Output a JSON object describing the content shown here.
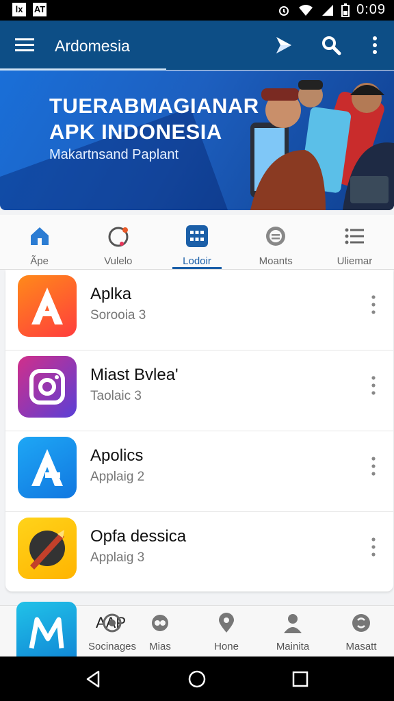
{
  "status_bar": {
    "left_icons": [
      "lx",
      "AT"
    ],
    "time": "0:09"
  },
  "appbar": {
    "title": "Ardomesia",
    "icons": [
      "menu-icon",
      "play-store-icon",
      "search-icon",
      "more-icon"
    ]
  },
  "banner": {
    "line1": "TUERABMAGIANAR",
    "line2": "APK INDONESIA",
    "line3": "Makartnsand Paplant"
  },
  "tabs": [
    {
      "label": "Ãpe",
      "icon": "home-icon",
      "active": false
    },
    {
      "label": "Vulelo",
      "icon": "video-icon",
      "active": false
    },
    {
      "label": "Lodoir",
      "icon": "grid-icon",
      "active": true
    },
    {
      "label": "Moants",
      "icon": "chat-icon",
      "active": false
    },
    {
      "label": "Uliemar",
      "icon": "list-icon",
      "active": false
    }
  ],
  "apps": [
    {
      "name": "Aplka",
      "sub": "Sorooia 3",
      "icon": "apk-a-icon",
      "color_from": "#ff7a1a",
      "color_to": "#ff3d3d"
    },
    {
      "name": "Miast Bvlea'",
      "sub": "Taolaic 3",
      "icon": "camera-icon",
      "color_from": "#d12f8a",
      "color_to": "#5a3fd6"
    },
    {
      "name": "Apolics",
      "sub": "Applaig 2",
      "icon": "app-store-icon",
      "color_from": "#1ea7f5",
      "color_to": "#1177e0"
    },
    {
      "name": "Opfa dessica",
      "sub": "Applaig 3",
      "icon": "brush-icon",
      "color_from": "#ffd31a",
      "color_to": "#ffb400"
    }
  ],
  "bottom_nav": {
    "overlay_text": "AAP",
    "items": [
      {
        "label": "Socinages",
        "icon": "settings-icon"
      },
      {
        "label": "Mias",
        "icon": "chat-icon"
      },
      {
        "label": "Hone",
        "icon": "location-icon"
      },
      {
        "label": "Mainita",
        "icon": "person-icon"
      },
      {
        "label": "Masatt",
        "icon": "money-icon"
      }
    ]
  },
  "colors": {
    "appbar": "#0d4e86",
    "accent": "#1b5fa8"
  }
}
